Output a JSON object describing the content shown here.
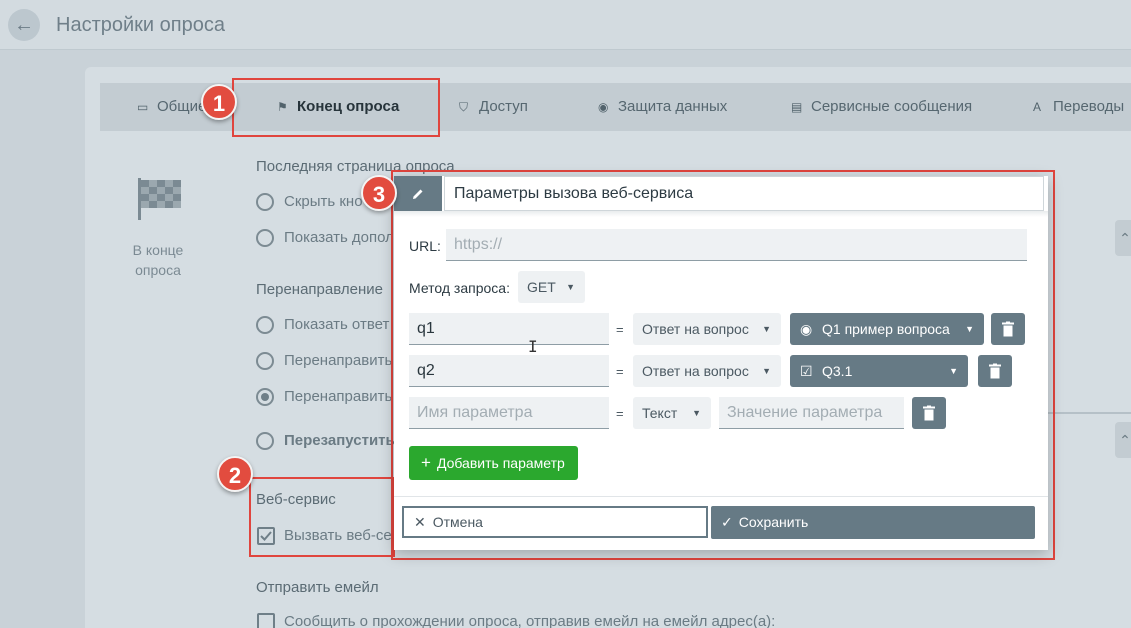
{
  "header": {
    "title": "Настройки опроса",
    "back_icon": "arrow-left-icon"
  },
  "tabs": [
    {
      "label": "Общие",
      "icon": "monitor-icon"
    },
    {
      "label": "Конец опроса",
      "icon": "flag-icon"
    },
    {
      "label": "Доступ",
      "icon": "shield-icon"
    },
    {
      "label": "Защита данных",
      "icon": "fingerprint-icon"
    },
    {
      "label": "Сервисные сообщения",
      "icon": "message-icon"
    },
    {
      "label": "Переводы",
      "icon": "translate-icon"
    }
  ],
  "side": {
    "label": "В конце опроса"
  },
  "sections": {
    "last_page": {
      "title": "Последняя страница опроса",
      "options": [
        "Скрыть кно",
        "Показать допол"
      ]
    },
    "redirect": {
      "title": "Перенаправление",
      "options": [
        "Показать ответ",
        "Перенаправить",
        "Перенаправить",
        "Перезапустить"
      ]
    },
    "webservice": {
      "title": "Веб-сервис",
      "checkbox_label": "Вызвать веб-се"
    },
    "email": {
      "title": "Отправить емейл",
      "checkbox_label": "Сообщить о прохождении опроса, отправив емейл на емейл адрес(а):"
    }
  },
  "badges": [
    "1",
    "2",
    "3"
  ],
  "dialog": {
    "title": "Параметры вызова веб-сервиса",
    "url_label": "URL:",
    "url_placeholder": "https://",
    "method_label": "Метод запроса:",
    "method_value": "GET",
    "equals": "=",
    "params": [
      {
        "name": "q1",
        "source": "Ответ на вопрос",
        "value": "Q1 пример вопроса",
        "value_icon": "radio-icon"
      },
      {
        "name": "q2",
        "source": "Ответ на вопрос",
        "value": "Q3.1",
        "value_icon": "checkbox-icon"
      }
    ],
    "new_param": {
      "name_placeholder": "Имя параметра",
      "source": "Текст",
      "value_placeholder": "Значение параметра"
    },
    "add_button": "Добавить параметр",
    "cancel_button": "Отмена",
    "save_button": "Сохранить"
  },
  "colors": {
    "annotation": "#e0453e",
    "primary": "#667a85",
    "success": "#2ba82e"
  }
}
